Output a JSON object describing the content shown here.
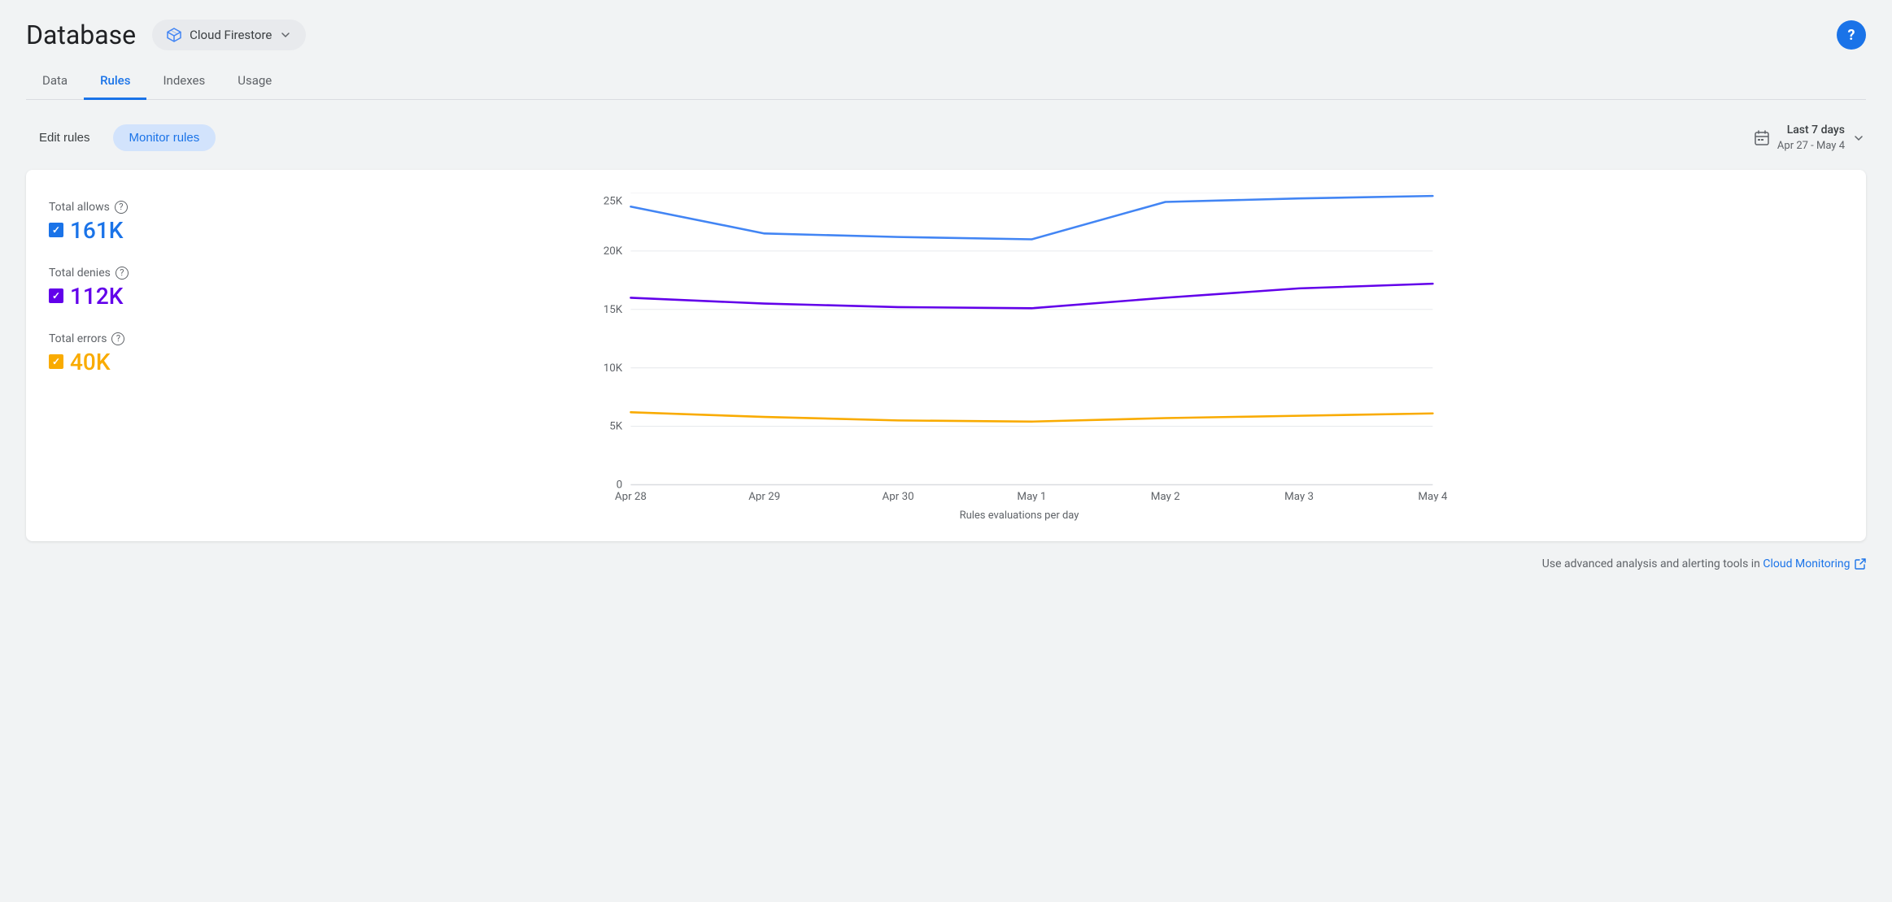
{
  "page": {
    "title": "Database",
    "service": "Cloud Firestore"
  },
  "tabs": [
    {
      "id": "data",
      "label": "Data",
      "active": false
    },
    {
      "id": "rules",
      "label": "Rules",
      "active": true
    },
    {
      "id": "indexes",
      "label": "Indexes",
      "active": false
    },
    {
      "id": "usage",
      "label": "Usage",
      "active": false
    }
  ],
  "toolbar": {
    "edit_rules_label": "Edit rules",
    "monitor_rules_label": "Monitor rules",
    "date_label": "Last 7 days",
    "date_range": "Apr 27 - May 4"
  },
  "legend": {
    "allows_label": "Total allows",
    "allows_value": "161K",
    "denies_label": "Total denies",
    "denies_value": "112K",
    "errors_label": "Total errors",
    "errors_value": "40K"
  },
  "chart": {
    "x_axis_label": "Rules evaluations per day",
    "x_labels": [
      "Apr 28",
      "Apr 29",
      "Apr 30",
      "May 1",
      "May 2",
      "May 3",
      "May 4"
    ],
    "y_labels": [
      "0",
      "5K",
      "10K",
      "15K",
      "20K",
      "25K"
    ],
    "allows_data": [
      23800,
      21500,
      21200,
      21000,
      24200,
      24500,
      25000
    ],
    "denies_data": [
      16000,
      15500,
      15200,
      15100,
      16000,
      16800,
      17200
    ],
    "errors_data": [
      6200,
      5800,
      5500,
      5400,
      5700,
      5900,
      6100
    ]
  },
  "footer": {
    "text": "Use advanced analysis and alerting tools in",
    "link_label": "Cloud Monitoring",
    "link_icon": "external-link"
  }
}
